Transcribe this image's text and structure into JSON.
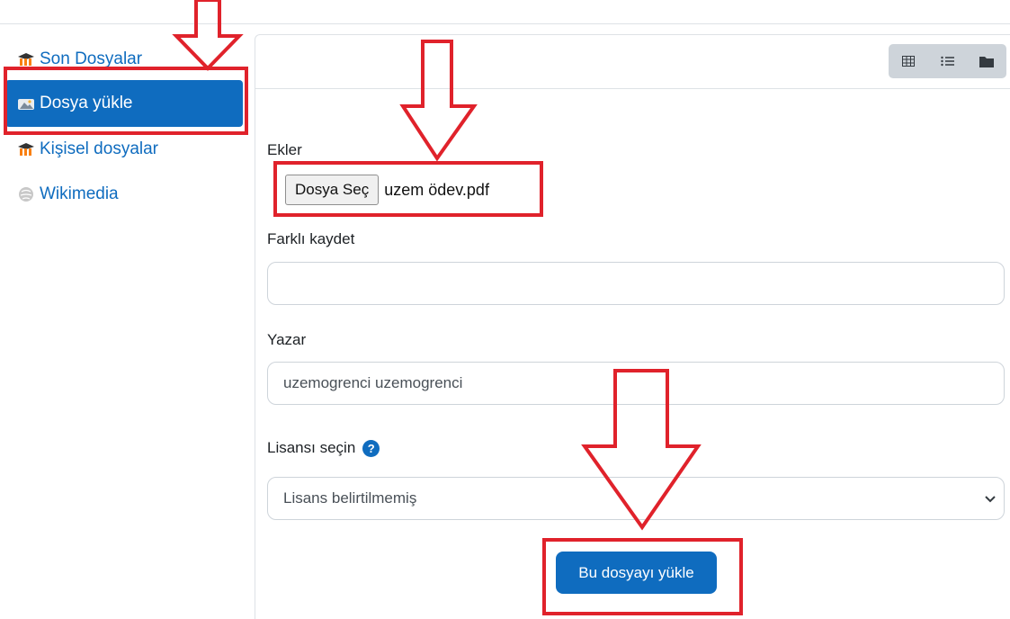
{
  "sidebar": {
    "items": [
      {
        "label": "Son Dosyalar",
        "icon": "moodle-icon"
      },
      {
        "label": "Dosya yükle",
        "icon": "upload-icon",
        "active": true
      },
      {
        "label": "Kişisel dosyalar",
        "icon": "moodle-icon"
      },
      {
        "label": "Wikimedia",
        "icon": "wikimedia-icon"
      }
    ]
  },
  "toolbar": {
    "views": [
      "grid-view-icon",
      "list-view-icon",
      "folder-view-icon"
    ]
  },
  "form": {
    "attachments_label": "Ekler",
    "choose_file_button": "Dosya Seç",
    "chosen_file": "uzem ödev.pdf",
    "save_as_label": "Farklı kaydet",
    "save_as_value": "",
    "author_label": "Yazar",
    "author_value": "uzemogrenci uzemogrenci",
    "license_label": "Lisansı seçin",
    "help_icon_text": "?",
    "license_selected": "Lisans belirtilmemiş",
    "upload_button": "Bu dosyayı yükle"
  },
  "colors": {
    "accent": "#0f6cbf",
    "annotation": "#e0222b",
    "border": "#ced4da"
  }
}
